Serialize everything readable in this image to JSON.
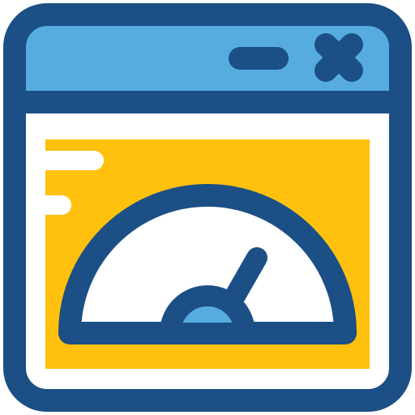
{
  "icon": {
    "name": "browser-window-speedometer-icon",
    "colors": {
      "outline": "#1b4f86",
      "titlebar": "#56acdf",
      "content_panel": "#ffc10e",
      "gauge_face": "#ffffff",
      "hub": "#56acdf",
      "background": "#ffffff"
    },
    "titlebar_controls": [
      "minimize-icon",
      "close-icon"
    ],
    "gauge": {
      "needle_direction": "upper-right"
    }
  }
}
